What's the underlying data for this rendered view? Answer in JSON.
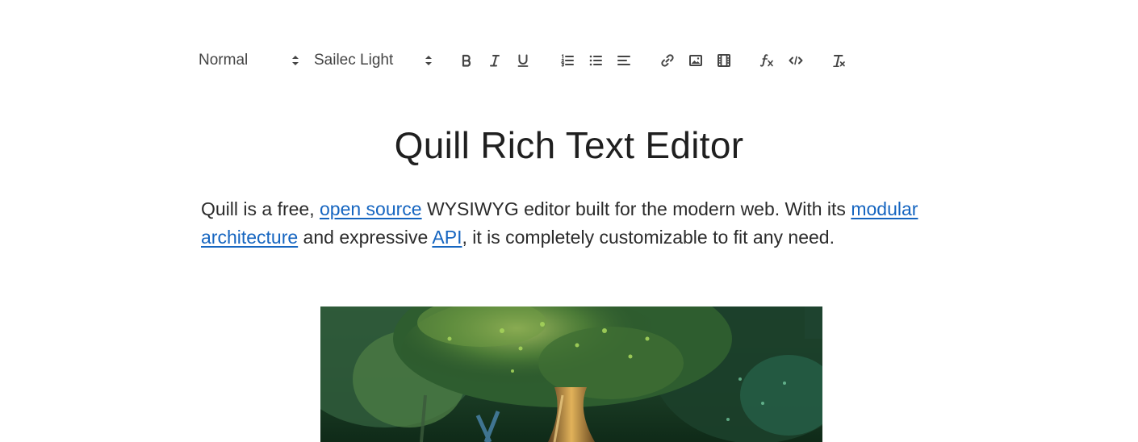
{
  "toolbar": {
    "header_picker": {
      "label": "Normal",
      "icon": "up-down-caret-icon"
    },
    "font_picker": {
      "label": "Sailec Light",
      "icon": "up-down-caret-icon"
    },
    "buttons": [
      {
        "name": "bold",
        "icon": "bold-icon"
      },
      {
        "name": "italic",
        "icon": "italic-icon"
      },
      {
        "name": "underline",
        "icon": "underline-icon"
      },
      {
        "name": "ordered-list",
        "icon": "ordered-list-icon"
      },
      {
        "name": "bullet-list",
        "icon": "bullet-list-icon"
      },
      {
        "name": "align",
        "icon": "align-left-icon"
      },
      {
        "name": "link",
        "icon": "link-icon"
      },
      {
        "name": "image",
        "icon": "image-icon"
      },
      {
        "name": "video",
        "icon": "video-icon"
      },
      {
        "name": "formula",
        "icon": "formula-icon"
      },
      {
        "name": "code-block",
        "icon": "code-icon"
      },
      {
        "name": "clean",
        "icon": "clear-format-icon"
      }
    ]
  },
  "content": {
    "title": "Quill Rich Text Editor",
    "intro": {
      "t1": "Quill is a free, ",
      "link1": "open source",
      "t2": " WYSIWYG editor built for the modern web. With its ",
      "link2": "modular architecture",
      "t3": " and expressive ",
      "link3": "API",
      "t4": ", it is completely customizable to fit any need."
    },
    "image": {
      "subject": "forest-tree-illustration"
    }
  },
  "colors": {
    "link": "#1565c0",
    "text": "#2b2b2b",
    "icon": "#444444"
  }
}
